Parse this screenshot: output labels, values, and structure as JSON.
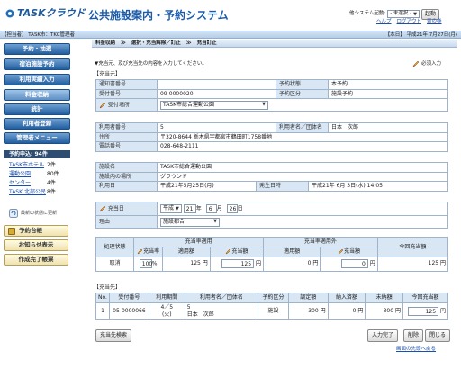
{
  "header": {
    "logo": "TASKクラウド",
    "title": "公共施設案内・予約システム",
    "system_label": "他システム起動:",
    "system_select": "- 未選択 -",
    "launch_btn": "起動",
    "help": "ヘルプ",
    "logout": "ログアウト",
    "home": "表の巻"
  },
  "userbar": {
    "user": "【担当者】 TASK市：TKC管理者",
    "today": "【本日】 平成21年 7月27日(月)"
  },
  "nav": {
    "items": [
      "予約・抽選",
      "宿泊施設予約",
      "利用実績入力",
      "料金収納",
      "統計",
      "利用者登録",
      "管理者メニュー"
    ],
    "active": 3
  },
  "side": {
    "title": "予約申込: 94件",
    "rows": [
      {
        "name": "TASK市ホテル",
        "count": "2件"
      },
      {
        "name": "運動公園",
        "count": "80件"
      },
      {
        "name": "センター",
        "count": "4件"
      },
      {
        "name": "TASK 北部公民",
        "count": "8件"
      }
    ],
    "refresh": "最新の状態に更新",
    "btn1": "予約台帳",
    "btn2": "お知らせ表示",
    "btn3": "作成完了帳票"
  },
  "breadcrumb": {
    "items": [
      "料金収納",
      "選択・充当解除／訂正",
      "充当訂正"
    ]
  },
  "instr": "▼充当元、及び充当先の内容を入力してください。",
  "required": "必須入力",
  "src": {
    "section": "【充当元】",
    "notify_label": "通知書番号",
    "notify_value": "",
    "status_label": "予約状態",
    "status_value": "本予約",
    "recv_label": "受付番号",
    "recv_value": "09-0000020",
    "kind_label": "予約区分",
    "kind_value": "施設予約",
    "place_label": "受付場所",
    "place_value": "TASK市総合運動公園"
  },
  "user": {
    "no_label": "利用者番号",
    "no_value": "5",
    "name_label": "利用者名／団体名",
    "name_value": "日本　次郎",
    "addr_label": "住所",
    "addr_value": "〒320-8644  栃木県宇都宮市鶴田町1758番地",
    "tel_label": "電話番号",
    "tel_value": "028-648-2111"
  },
  "facility": {
    "name_label": "施設名",
    "name_value": "TASK市総合運動公園",
    "place_label": "施設内の場所",
    "place_value": "グラウンド",
    "date_label": "利用日",
    "date_value": "平成21年5月25日(月)",
    "occur_label": "発生日時",
    "occur_value": "平成21年 6月 3日(水) 14:05"
  },
  "charge": {
    "date_label": "充当日",
    "era": "平成",
    "year": "21",
    "month": "6",
    "day": "26",
    "year_unit": "年",
    "month_unit": "月",
    "day_unit": "日",
    "reason_label": "理由",
    "reason_value": "施設都合"
  },
  "grid": {
    "h_state": "処理状態",
    "h_use": "充当率適用",
    "h_out": "充当率適用外",
    "h_cur": "今回充当額",
    "h_rate": "充当率",
    "h_applied": "適用額",
    "h_amount": "充当額",
    "h_applied2": "適用額",
    "h_amount2": "充当額",
    "state": "取消",
    "rate": "100",
    "rate_unit": "%",
    "applied": "125 円",
    "amount": "125",
    "yen": "円",
    "applied2": "0 円",
    "amount2": "0",
    "cur": "125 円"
  },
  "dest": {
    "section": "【充当先】",
    "headers": [
      "No.",
      "受付番号",
      "利用期間",
      "利用者名／団体名",
      "予約区分",
      "調定額",
      "納入済額",
      "未納額",
      "今回充当額"
    ],
    "row": {
      "no": "1",
      "recv": "05-0000066",
      "period1": "4／5",
      "period2": "(火)",
      "user1": "5",
      "user2": "日本　次郎",
      "kind": "施設",
      "charge": "300 円",
      "paid": "0 円",
      "unpaid": "300 円",
      "cur": "125",
      "yen": "円"
    }
  },
  "actions": {
    "search": "充当先検索",
    "done": "入力完了",
    "delete": "削除",
    "close": "閉じる",
    "back": "画面の先頭へ戻る"
  }
}
